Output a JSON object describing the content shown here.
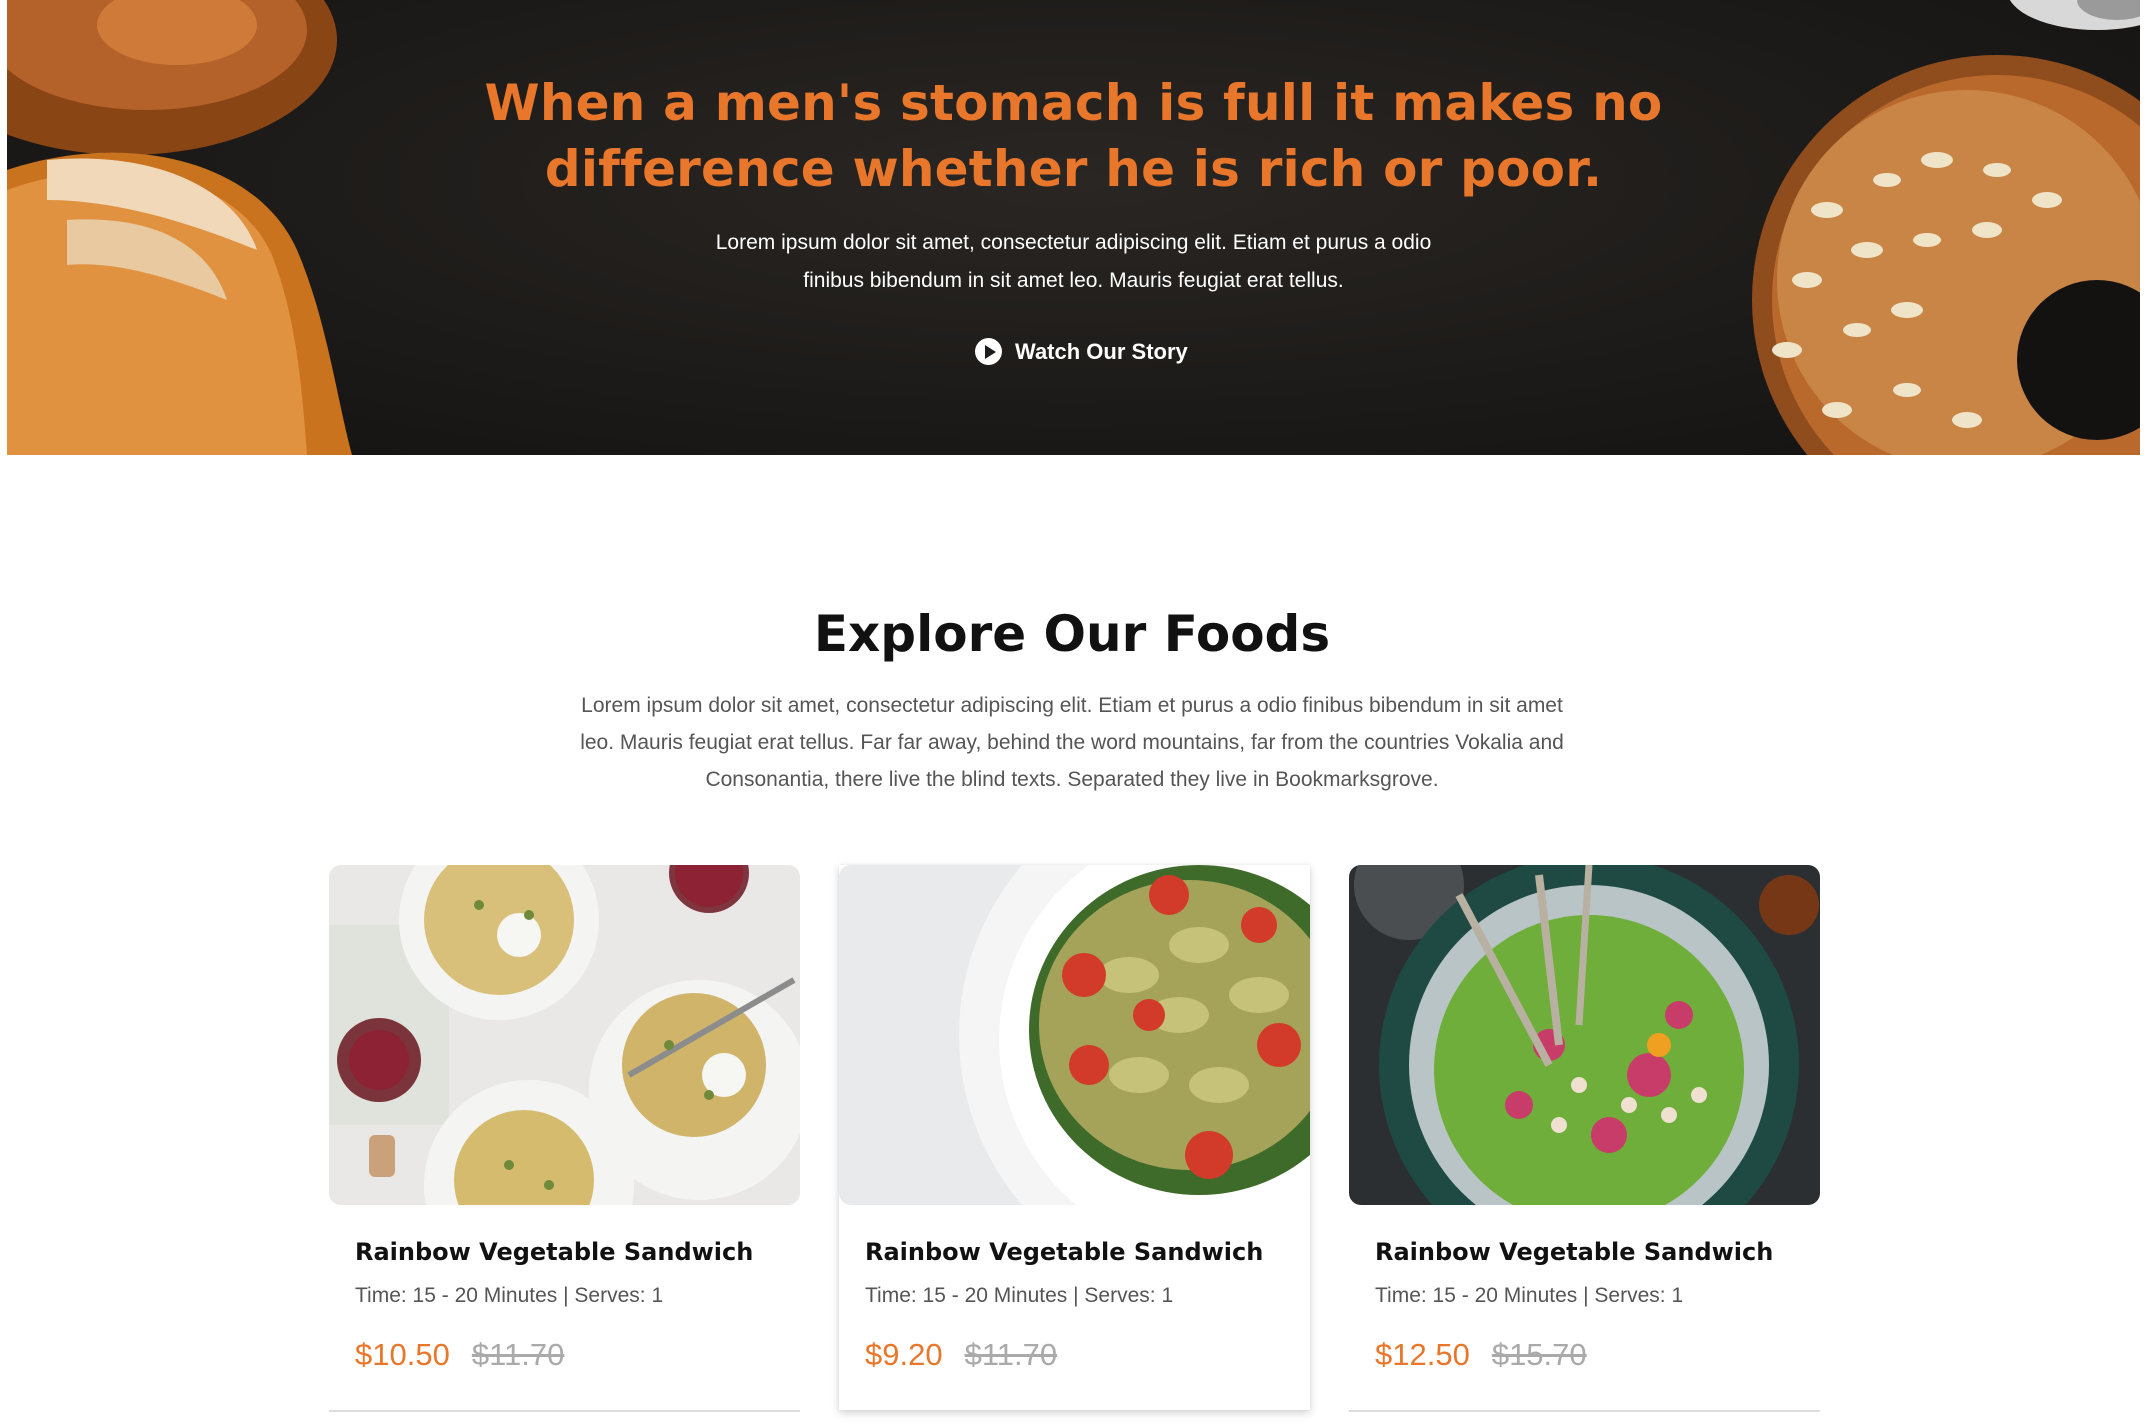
{
  "hero": {
    "quote_line1": "When a men's stomach is full it makes no",
    "quote_line2": "difference whether he is rich or poor.",
    "sub_line1": "Lorem ipsum dolor sit amet, consectetur adipiscing elit. Etiam et purus a odio",
    "sub_line2": "finibus bibendum in sit amet leo. Mauris feugiat erat tellus.",
    "watch_label": "Watch Our Story",
    "watch_icon": "play-circle-icon"
  },
  "foods": {
    "title": "Explore Our Foods",
    "desc_line1": "Lorem ipsum dolor sit amet, consectetur adipiscing elit. Etiam et purus a odio finibus bibendum in sit amet",
    "desc_line2": "leo. Mauris feugiat erat tellus. Far far away, behind the word mountains, far from the countries Vokalia and",
    "desc_line3": "Consonantia, there live the blind texts. Separated they live in Bookmarksgrove.",
    "cards": [
      {
        "title": "Rainbow Vegetable Sandwich",
        "meta": "Time: 15 - 20 Minutes | Serves: 1",
        "price": "$10.50",
        "old_price": "$11.70"
      },
      {
        "title": "Rainbow Vegetable Sandwich",
        "meta": "Time: 15 - 20 Minutes | Serves: 1",
        "price": "$9.20",
        "old_price": "$11.70"
      },
      {
        "title": "Rainbow Vegetable Sandwich",
        "meta": "Time: 15 - 20 Minutes | Serves: 1",
        "price": "$12.50",
        "old_price": "$15.70"
      }
    ]
  },
  "colors": {
    "accent": "#e8772b",
    "hero_bg": "#1d1b19",
    "text_dark": "#111111",
    "text_muted": "#555555"
  }
}
